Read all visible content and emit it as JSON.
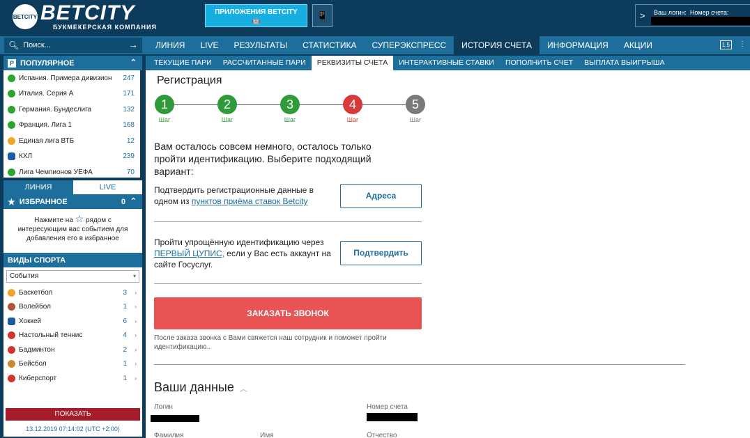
{
  "header": {
    "logo_ball": "BETCITY",
    "logo_main": "BETCITY",
    "logo_sub": "БУКМЕКЕРСКАЯ КОМПАНИЯ",
    "apps_label": "ПРИЛОЖЕНИЯ BETCITY",
    "apps_icons": "🤖 ",
    "phone_icon": "📱",
    "login_arrow": ">",
    "login_label": "Ваш логин:",
    "account_label": "Номер счета:"
  },
  "nav": {
    "search_placeholder": "Поиск...",
    "search_go": "→",
    "items": [
      "ЛИНИЯ",
      "LIVE",
      "РЕЗУЛЬТАТЫ",
      "СТАТИСТИКА",
      "СУПЕРЭКСПРЕСС",
      "ИСТОРИЯ СЧЕТА",
      "ИНФОРМАЦИЯ",
      "АКЦИИ"
    ],
    "active_index": 5,
    "right_badge": "1.5",
    "right_icon": "⋮"
  },
  "sidebar": {
    "popular_title": "ПОПУЛЯРНОЕ",
    "popular_icon": "P",
    "chevron_up": "⌃",
    "popular": [
      {
        "name": "Испания. Примера дивизион",
        "count": "247",
        "icon": "soccer"
      },
      {
        "name": "Италия. Серия А",
        "count": "171",
        "icon": "soccer"
      },
      {
        "name": "Германия. Бундеслига",
        "count": "132",
        "icon": "soccer"
      },
      {
        "name": "Франция. Лига 1",
        "count": "168",
        "icon": "soccer"
      },
      {
        "name": "Единая лига ВТБ",
        "count": "12",
        "icon": "basketball"
      },
      {
        "name": "КХЛ",
        "count": "239",
        "icon": "hockey"
      },
      {
        "name": "Лига Чемпионов УЕФА",
        "count": "70",
        "icon": "soccer"
      }
    ],
    "tab_line": "ЛИНИЯ",
    "tab_live": "LIVE",
    "favorites_title": "ИЗБРАННОЕ",
    "favorites_count": "0",
    "favorites_star": "★",
    "favorites_note_a": "Нажмите на",
    "favorites_note_star": "☆",
    "favorites_note_b": "рядом с интересующим вас событием для добавления его в избранное",
    "sports_title": "ВИДЫ СПОРТА",
    "select_value": "События",
    "select_arrow": "▾",
    "sports": [
      {
        "name": "Баскетбол",
        "count": "3",
        "icon": "basketball"
      },
      {
        "name": "Волейбол",
        "count": "1",
        "icon": "volleyball"
      },
      {
        "name": "Хоккей",
        "count": "6",
        "icon": "hockey"
      },
      {
        "name": "Настольный теннис",
        "count": "4",
        "icon": "table-tennis"
      },
      {
        "name": "Бадминтон",
        "count": "2",
        "icon": "badminton"
      },
      {
        "name": "Бейсбол",
        "count": "1",
        "icon": "baseball"
      },
      {
        "name": "Киберспорт",
        "count": "1",
        "icon": "esports"
      }
    ],
    "sport_arrow": "›",
    "show_button": "ПОКАЗАТЬ",
    "datetime": "13.12.2019 07:14:02 (UTC +2:00)"
  },
  "subtabs": {
    "items": [
      "ТЕКУЩИЕ ПАРИ",
      "РАССЧИТАННЫЕ ПАРИ",
      "РЕКВИЗИТЫ СЧЕТА",
      "ИНТЕРАКТИВНЫЕ СТАВКИ",
      "ПОПОЛНИТЬ СЧЕТ",
      "ВЫПЛАТА ВЫИГРЫША"
    ],
    "active_index": 2
  },
  "registration": {
    "title": "Регистрация",
    "steps": [
      {
        "num": "1",
        "label": "Шаг",
        "state": "done"
      },
      {
        "num": "2",
        "label": "Шаг",
        "state": "done"
      },
      {
        "num": "3",
        "label": "Шаг",
        "state": "done"
      },
      {
        "num": "4",
        "label": "Шаг",
        "state": "current"
      },
      {
        "num": "5",
        "label": "Шаг",
        "state": "pending"
      }
    ],
    "colors": {
      "done": "#2f9a3a",
      "current": "#d83a3a",
      "pending": "#7a7a7a"
    },
    "lead": "Вам осталось совсем немного, осталось только пройти идентификацию. Выберите подходящий вариант:",
    "option1_a": "Подтвердить регистрационные данные в одном из ",
    "option1_link": "пунктов приёма ставок Betcity",
    "option1_button": "Адреса",
    "option2_a": "Пройти упрощённую идентификацию через ",
    "option2_link": "ПЕРВЫЙ ЦУПИС,",
    "option2_b": " если у Вас есть аккаунт на сайте Госуслуг.",
    "option2_button": "Подтвердить",
    "call_button": "ЗАКАЗАТЬ ЗВОНОК",
    "call_note": "После заказа звонка с Вами свяжется наш сотрудник и поможет пройти идентификацию.."
  },
  "your_data": {
    "title": "Ваши данные",
    "chevron": "︿",
    "login_label": "Логин",
    "account_label": "Номер счета",
    "surname_label": "Фамилия",
    "name_label": "Имя",
    "patronymic_label": "Отчество"
  }
}
